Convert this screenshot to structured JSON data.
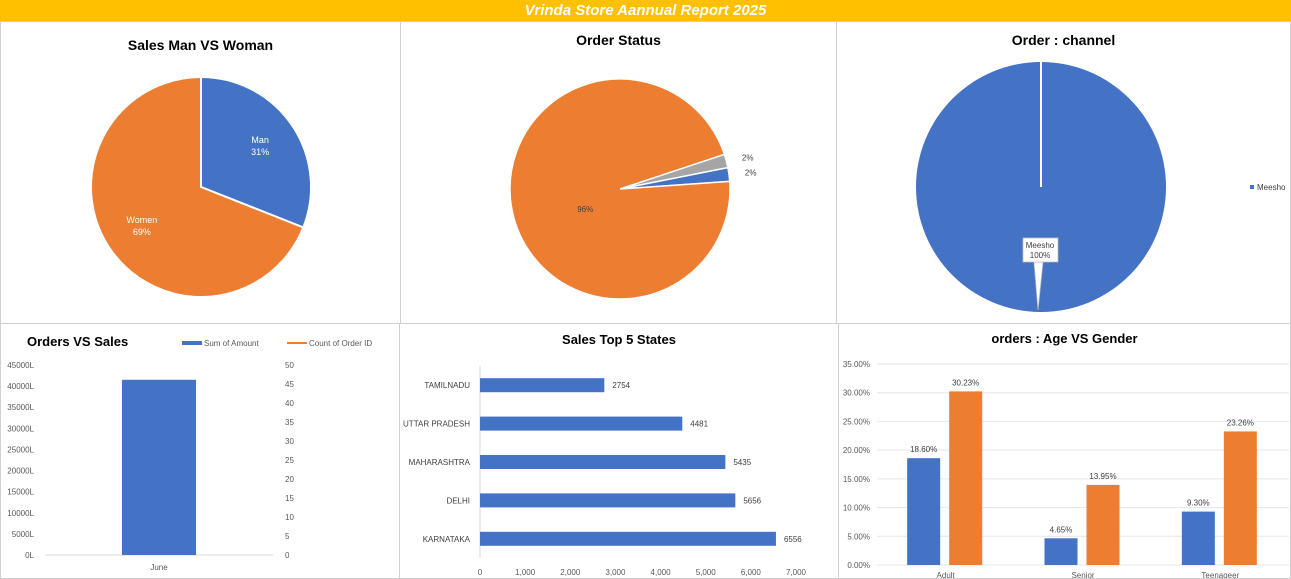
{
  "banner": {
    "title": "Vrinda Store Aannual Report 2025",
    "color": "#FFC000"
  },
  "chart_data": [
    {
      "id": "gender",
      "type": "pie",
      "title": "Sales Man VS Woman",
      "slices": [
        {
          "label": "Man",
          "value": 31,
          "display": "31%",
          "color": "#4472C4"
        },
        {
          "label": "Women",
          "value": 69,
          "display": "69%",
          "color": "#ED7D31"
        }
      ]
    },
    {
      "id": "status",
      "type": "pie",
      "title": "Order Status",
      "slices": [
        {
          "value": 2,
          "display": "2%",
          "color": "#A5A5A5"
        },
        {
          "value": 2,
          "display": "2%",
          "color": "#4472C4"
        },
        {
          "value": 96,
          "display": "96%",
          "color": "#ED7D31"
        }
      ]
    },
    {
      "id": "channel",
      "type": "pie",
      "title": "Order : channel",
      "slices": [
        {
          "label": "Meesho",
          "value": 100,
          "display": "100%",
          "color": "#4472C4"
        }
      ],
      "legend": [
        "Meesho"
      ],
      "legend_position": "right"
    },
    {
      "id": "orders_sales",
      "type": "bar",
      "title": "Orders VS Sales",
      "categories": [
        "June"
      ],
      "series": [
        {
          "name": "Sum of Amount",
          "values": [
            41500
          ],
          "color": "#4472C4"
        },
        {
          "name": "Count of Order ID",
          "values": [],
          "color": "#ED7D31"
        }
      ],
      "ylim": [
        0,
        45000
      ],
      "yticks": [
        "0L",
        "5000L",
        "10000L",
        "15000L",
        "20000L",
        "25000L",
        "30000L",
        "35000L",
        "40000L",
        "45000L"
      ],
      "y2lim": [
        0,
        50
      ],
      "y2ticks": [
        "0",
        "5",
        "10",
        "15",
        "20",
        "25",
        "30",
        "35",
        "40",
        "45",
        "50"
      ],
      "legend_position": "top"
    },
    {
      "id": "top_states",
      "type": "bar",
      "orientation": "horizontal",
      "title": "Sales Top 5 States",
      "categories": [
        "TAMILNADU",
        "UTTAR PRADESH",
        "MAHARASHTRA",
        "DELHI",
        "KARNATAKA"
      ],
      "values": [
        2754,
        4481,
        5435,
        5656,
        6556
      ],
      "labels": [
        "2754",
        "4481",
        "5435",
        "5656",
        "6556"
      ],
      "xlim": [
        0,
        7000
      ],
      "xticks": [
        "0",
        "1,000",
        "2,000",
        "3,000",
        "4,000",
        "5,000",
        "6,000",
        "7,000"
      ],
      "color": "#4472C4"
    },
    {
      "id": "age_gender",
      "type": "bar",
      "title": "orders : Age VS Gender",
      "categories": [
        "Adult",
        "Senior",
        "Teenageer"
      ],
      "series": [
        {
          "values": [
            18.6,
            4.65,
            9.3
          ],
          "labels": [
            "18.60%",
            "4.65%",
            "9.30%"
          ],
          "color": "#4472C4"
        },
        {
          "values": [
            30.23,
            13.95,
            23.26
          ],
          "labels": [
            "30.23%",
            "13.95%",
            "23.26%"
          ],
          "color": "#ED7D31"
        }
      ],
      "ylim": [
        0,
        35
      ],
      "yticks": [
        "0.00%",
        "5.00%",
        "10.00%",
        "15.00%",
        "20.00%",
        "25.00%",
        "30.00%",
        "35.00%"
      ]
    }
  ]
}
